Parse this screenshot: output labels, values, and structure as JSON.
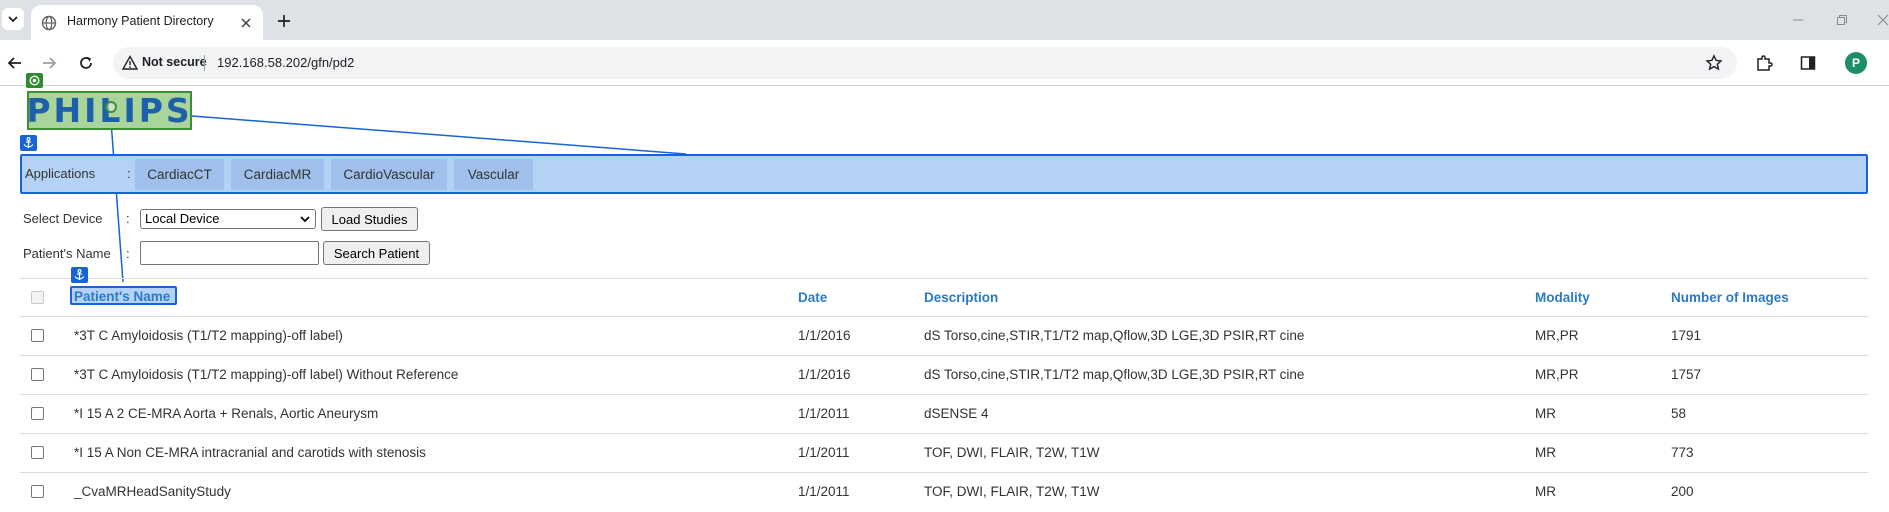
{
  "browser": {
    "tab_title": "Harmony Patient Directory",
    "security_label": "Not secure",
    "url": "192.168.58.202/gfn/pd2",
    "profile_initial": "P"
  },
  "page": {
    "logo_text": "PHILIPS",
    "applications": {
      "label": "Applications",
      "separator": ":",
      "tabs": [
        "CardiacCT",
        "CardiacMR",
        "CardioVascular",
        "Vascular"
      ]
    },
    "device": {
      "label": "Select Device",
      "separator": ":",
      "selected": "Local Device",
      "button": "Load Studies"
    },
    "patient_search": {
      "label": "Patient's Name",
      "separator": ":",
      "value": "",
      "button": "Search Patient"
    },
    "table": {
      "headers": {
        "name": "Patient's Name",
        "date": "Date",
        "description": "Description",
        "modality": "Modality",
        "images": "Number of Images"
      },
      "rows": [
        {
          "name": "*3T C Amyloidosis (T1/T2 mapping)-off label)",
          "date": "1/1/2016",
          "description": "dS Torso,cine,STIR,T1/T2 map,Qflow,3D LGE,3D PSIR,RT cine",
          "modality": "MR,PR",
          "images": "1791"
        },
        {
          "name": "*3T C Amyloidosis (T1/T2 mapping)-off label) Without Reference",
          "date": "1/1/2016",
          "description": "dS Torso,cine,STIR,T1/T2 map,Qflow,3D LGE,3D PSIR,RT cine",
          "modality": "MR,PR",
          "images": "1757"
        },
        {
          "name": "*I 15 A 2 CE-MRA Aorta + Renals, Aortic Aneurysm",
          "date": "1/1/2011",
          "description": "dSENSE 4",
          "modality": "MR",
          "images": "58"
        },
        {
          "name": "*I 15 A Non CE-MRA intracranial and carotids with stenosis",
          "date": "1/1/2011",
          "description": "TOF, DWI, FLAIR, T2W, T1W",
          "modality": "MR",
          "images": "773"
        },
        {
          "name": "_CvaMRHeadSanityStudy",
          "date": "1/1/2011",
          "description": "TOF, DWI, FLAIR, T2W, T1W",
          "modality": "MR",
          "images": "200"
        }
      ]
    }
  },
  "colors": {
    "highlight_fill": "#b4d1f6",
    "highlight_border": "#1565d8",
    "logo_fill": "#a9d49a",
    "logo_border": "#3d8f36",
    "logo_text": "#1d5fa8",
    "header_link": "#2b7bc4"
  },
  "icons": {
    "tab_list": "chevron-down-icon",
    "favicon": "globe-icon",
    "tab_close": "close-icon",
    "new_tab": "plus-icon",
    "back": "arrow-left-icon",
    "forward": "arrow-right-icon",
    "reload": "reload-icon",
    "security": "warning-icon",
    "bookmark": "star-icon",
    "extensions": "puzzle-icon",
    "side_panel": "side-panel-icon",
    "green_marker": "target-icon",
    "blue_marker": "anchor-icon"
  }
}
